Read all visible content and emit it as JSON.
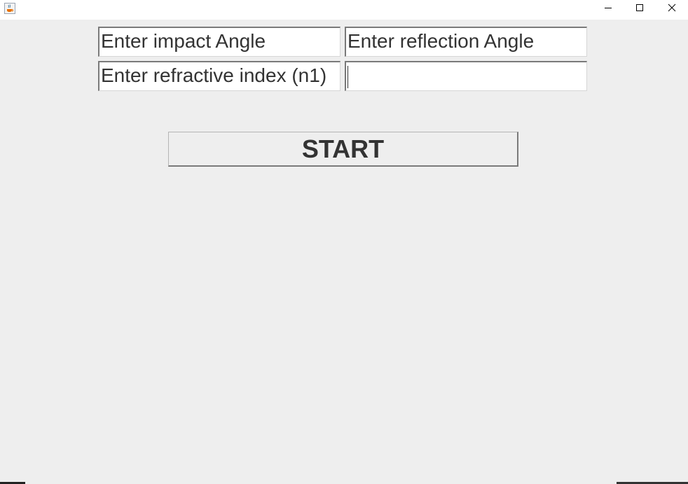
{
  "window": {
    "icon": "java-cup-icon",
    "controls": {
      "minimize_icon": "minimize-icon",
      "maximize_icon": "maximize-icon",
      "close_icon": "close-icon"
    }
  },
  "form": {
    "impact_angle": {
      "value": "Enter impact Angle"
    },
    "reflection_angle": {
      "value": "Enter reflection Angle"
    },
    "refractive_index": {
      "value": "Enter refractive index (n1)"
    },
    "empty_field": {
      "value": ""
    }
  },
  "start_button": {
    "label": "START"
  },
  "colors": {
    "background": "#eeeeee",
    "titlebar": "#ffffff",
    "text": "#333333",
    "field_bg": "#ffffff"
  }
}
